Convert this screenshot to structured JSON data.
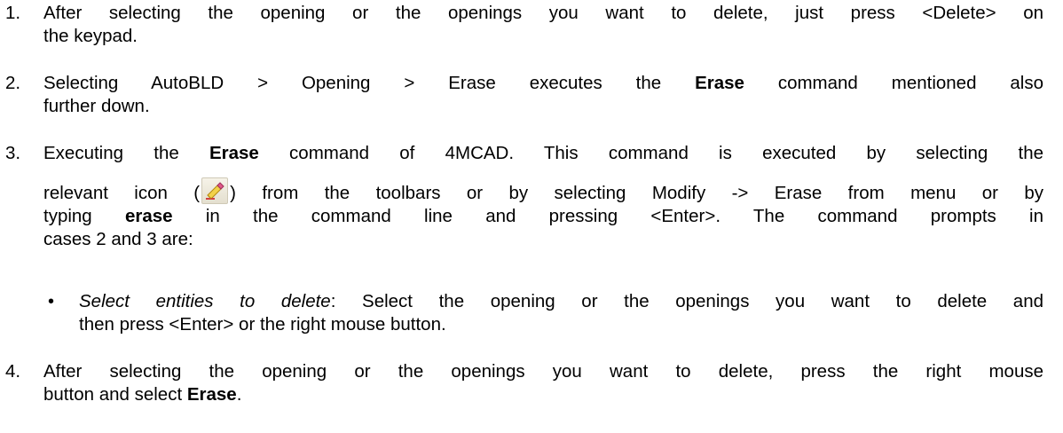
{
  "items": [
    {
      "number": "1.",
      "lines": [
        "After selecting the opening or the openings you want to delete, just press <Delete> on",
        "the keypad."
      ]
    },
    {
      "number": "2.",
      "line1_pre": "Selecting AutoBLD > Opening > Erase executes the ",
      "line1_bold": "Erase",
      "line1_post": " command mentioned also",
      "line2": "further down."
    },
    {
      "number": "3.",
      "line1_pre": "Executing the ",
      "line1_bold": "Erase",
      "line1_post": " command of 4MCAD. This command is executed by selecting the",
      "line2_pre": "relevant icon (",
      "line2_post": ") from the toolbars or by selecting Modify -> Erase from menu or by",
      "line3_bold": "erase",
      "line3_post": " in the command line and pressing <Enter>. The command prompts in",
      "line3_pre": "typing ",
      "line4": "cases 2 and 3 are:"
    },
    {
      "number": "4.",
      "line1": "After selecting the opening or the openings you want to delete, press the right mouse",
      "line2_pre": "button and select ",
      "line2_bold": "Erase",
      "line2_post": "."
    }
  ],
  "bullet": {
    "symbol": "•",
    "italic": "Select entities to delete",
    "line1_post": ": Select the opening or the openings you want to delete and",
    "line2": "then press <Enter> or the right mouse button."
  },
  "icon": "erase-icon"
}
